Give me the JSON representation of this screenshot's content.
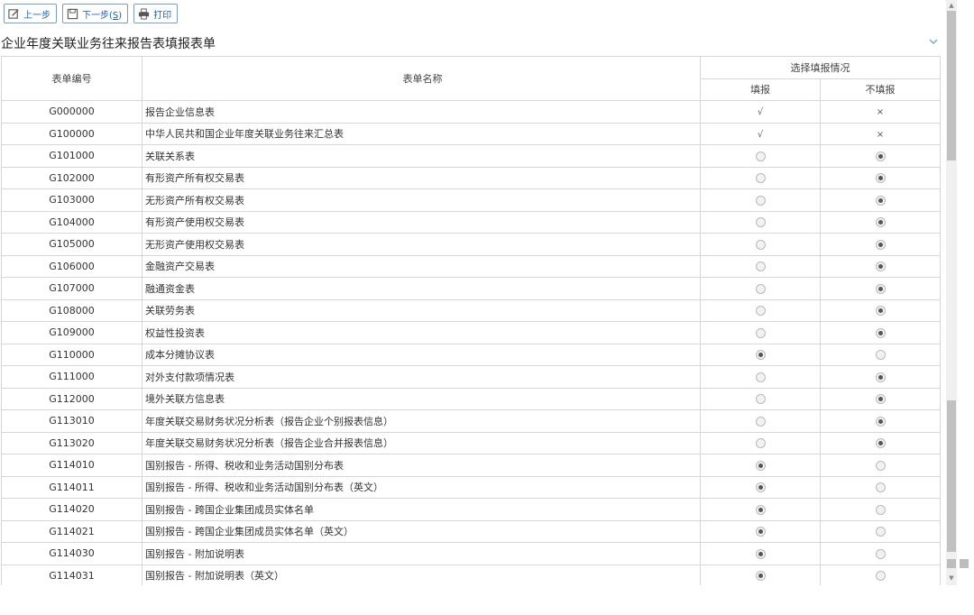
{
  "toolbar": {
    "prev_label": "上一步",
    "next_label": "下一步(",
    "next_key": "S",
    "next_close": ")",
    "print_label": "打印"
  },
  "page_title": "企业年度关联业务往来报告表填报表单",
  "table": {
    "headers": {
      "code": "表单编号",
      "name": "表单名称",
      "choice": "选择填报情况",
      "fill": "填报",
      "nofill": "不填报"
    },
    "rows": [
      {
        "code": "G000000",
        "name": "报告企业信息表",
        "fill": "√",
        "nofill": "×"
      },
      {
        "code": "G100000",
        "name": "中华人民共和国企业年度关联业务往来汇总表",
        "fill": "√",
        "nofill": "×"
      },
      {
        "code": "G101000",
        "name": "关联关系表",
        "selected": "nofill"
      },
      {
        "code": "G102000",
        "name": "有形资产所有权交易表",
        "selected": "nofill"
      },
      {
        "code": "G103000",
        "name": "无形资产所有权交易表",
        "selected": "nofill"
      },
      {
        "code": "G104000",
        "name": "有形资产使用权交易表",
        "selected": "nofill"
      },
      {
        "code": "G105000",
        "name": "无形资产使用权交易表",
        "selected": "nofill"
      },
      {
        "code": "G106000",
        "name": "金融资产交易表",
        "selected": "nofill"
      },
      {
        "code": "G107000",
        "name": "融通资金表",
        "selected": "nofill"
      },
      {
        "code": "G108000",
        "name": "关联劳务表",
        "selected": "nofill"
      },
      {
        "code": "G109000",
        "name": "权益性投资表",
        "selected": "nofill"
      },
      {
        "code": "G110000",
        "name": "成本分摊协议表",
        "selected": "fill"
      },
      {
        "code": "G111000",
        "name": "对外支付款项情况表",
        "selected": "nofill"
      },
      {
        "code": "G112000",
        "name": "境外关联方信息表",
        "selected": "nofill"
      },
      {
        "code": "G113010",
        "name": "年度关联交易财务状况分析表（报告企业个别报表信息）",
        "selected": "nofill"
      },
      {
        "code": "G113020",
        "name": "年度关联交易财务状况分析表（报告企业合并报表信息）",
        "selected": "nofill"
      },
      {
        "code": "G114010",
        "name": "国别报告 - 所得、税收和业务活动国别分布表",
        "selected": "fill"
      },
      {
        "code": "G114011",
        "name": "国别报告 - 所得、税收和业务活动国别分布表（英文）",
        "selected": "fill"
      },
      {
        "code": "G114020",
        "name": "国别报告 - 跨国企业集团成员实体名单",
        "selected": "fill"
      },
      {
        "code": "G114021",
        "name": "国别报告 - 跨国企业集团成员实体名单（英文）",
        "selected": "fill"
      },
      {
        "code": "G114030",
        "name": "国别报告 - 附加说明表",
        "selected": "fill"
      },
      {
        "code": "G114031",
        "name": "国别报告 - 附加说明表（英文）",
        "selected": "fill"
      }
    ]
  },
  "icons": {
    "prev": "edit-icon",
    "next": "save-icon",
    "print": "printer-icon",
    "collapse": "chevron-down-icon"
  },
  "colors": {
    "accent": "#1f5fa8",
    "border": "#d6d6d6"
  }
}
